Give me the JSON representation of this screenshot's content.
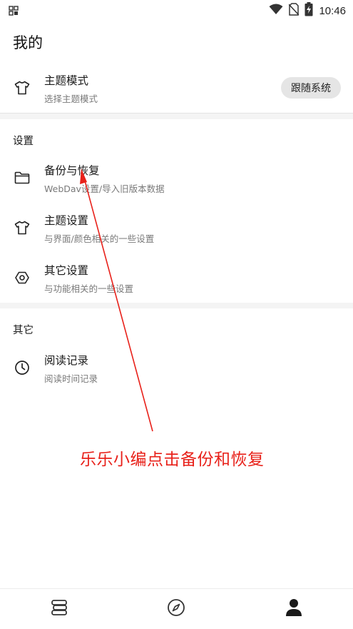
{
  "status_bar": {
    "time": "10:46",
    "left_icon": "grid-icon",
    "icons": [
      "wifi-icon",
      "no-sim-icon",
      "battery-charging-icon"
    ]
  },
  "page": {
    "title": "我的"
  },
  "theme_mode": {
    "title": "主题模式",
    "subtitle": "选择主题模式",
    "button_label": "跟随系统",
    "icon": "shirt-icon"
  },
  "settings": {
    "header": "设置",
    "items": [
      {
        "title": "备份与恢复",
        "subtitle": "WebDav设置/导入旧版本数据",
        "icon": "folder-icon"
      },
      {
        "title": "主题设置",
        "subtitle": "与界面/颜色相关的一些设置",
        "icon": "shirt-icon"
      },
      {
        "title": "其它设置",
        "subtitle": "与功能相关的一些设置",
        "icon": "gear-icon"
      }
    ]
  },
  "other": {
    "header": "其它",
    "items": [
      {
        "title": "阅读记录",
        "subtitle": "阅读时间记录",
        "icon": "clock-icon"
      }
    ]
  },
  "annotation": {
    "text": "乐乐小编点击备份和恢复",
    "color": "#e8211a"
  },
  "bottom_nav": {
    "items": [
      {
        "icon": "bookshelf-icon",
        "active": false
      },
      {
        "icon": "compass-icon",
        "active": false
      },
      {
        "icon": "person-icon",
        "active": true
      }
    ]
  }
}
